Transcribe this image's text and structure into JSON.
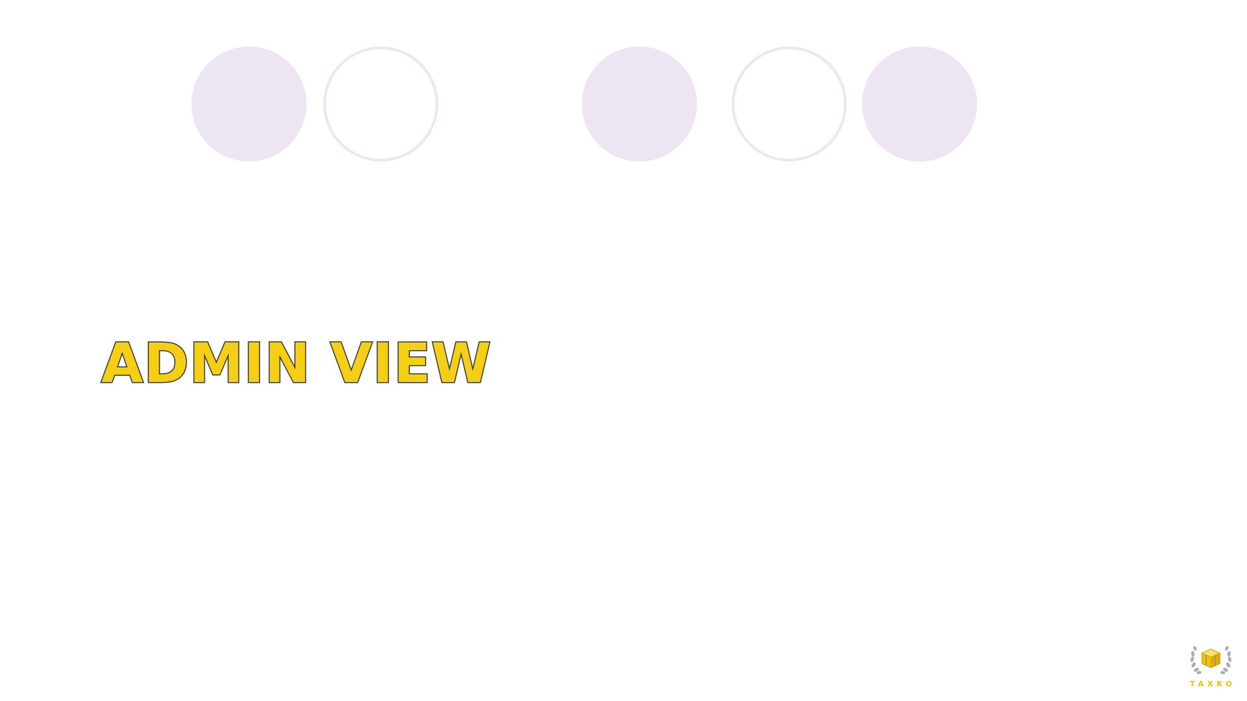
{
  "slide": {
    "title": "ADMIN VIEW"
  },
  "decoration": {
    "dot_color": "#ede6f2",
    "dots": [
      "filled",
      "outline",
      "filled",
      "outline",
      "filled"
    ]
  },
  "logo": {
    "text": "TAXKO",
    "text_color": "#f2c200",
    "icon": "laurel-box-icon"
  },
  "colors": {
    "title_fill": "#f5cf16",
    "title_stroke": "#3b3b3b",
    "background": "#ffffff"
  }
}
